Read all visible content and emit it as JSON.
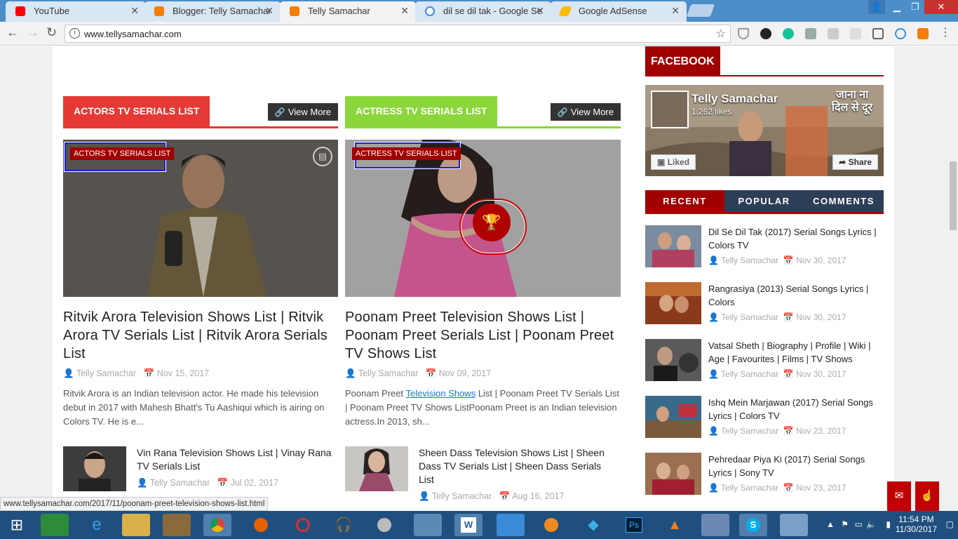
{
  "browser": {
    "tabs": [
      {
        "title": "YouTube",
        "color": "#ff0000"
      },
      {
        "title": "Blogger: Telly Samachar",
        "color": "#f57d00"
      },
      {
        "title": "Telly Samachar",
        "color": "#f57d00"
      },
      {
        "title": "dil se dil tak - Google Se",
        "color": "#4285f4"
      },
      {
        "title": "Google AdSense",
        "color": "#fbbc05"
      }
    ],
    "url": "www.tellysamachar.com",
    "status_url": "www.tellysamachar.com/2017/11/poonam-preet-television-shows-list.html"
  },
  "page": {
    "sections": [
      {
        "heading": "ACTORS TV SERIALS LIST",
        "accent": "#e53935",
        "view_more": "View More",
        "featured": {
          "tag": "ACTORS TV SERIALS LIST",
          "title": "Ritvik Arora Television Shows List | Ritvik Arora TV Serials List | Ritvik Arora Serials List",
          "author": "Telly Samachar",
          "date": "Nov 15, 2017",
          "excerpt": "Ritvik Arora is an Indian television actor. He made his television debut in 2017 with Mahesh Bhatt's Tu Aashiqui which is airing on Colors TV. He is e..."
        },
        "mini": {
          "title": "Vin Rana Television Shows List | Vinay Rana TV Serials List",
          "author": "Telly Samachar",
          "date": "Jul 02, 2017"
        }
      },
      {
        "heading": "ACTRESS TV SERIALS LIST",
        "accent": "#8bd63a",
        "view_more": "View More",
        "featured": {
          "tag": "ACTRESS TV SERIALS LIST",
          "title": "Poonam Preet Television Shows List | Poonam Preet Serials List | Poonam Preet TV Shows List",
          "author": "Telly Samachar",
          "date": "Nov 09, 2017",
          "excerpt_pre": "Poonam Preet ",
          "excerpt_link": "Television Shows",
          "excerpt_post": " List | Poonam Preet TV Serials List | Poonam Preet TV Shows ListPoonam Preet is an Indian television actress.In 2013, sh..."
        },
        "mini": {
          "title": "Sheen Dass Television Shows List | Sheen Dass TV Serials List | Sheen Dass Serials List",
          "author": "Telly Samachar",
          "date": "Aug 16, 2017"
        }
      }
    ]
  },
  "sidebar": {
    "facebook_heading": "FACEBOOK",
    "fb": {
      "page_name": "Telly Samachar",
      "likes": "1,262 likes",
      "liked_label": "Liked",
      "share_label": "Share",
      "cover_text": "जाना ना दिल से दूर"
    },
    "tabs": [
      "RECENT",
      "POPULAR",
      "COMMENTS"
    ],
    "recent": [
      {
        "title": "Dil Se Dil Tak (2017) Serial Songs Lyrics | Colors TV",
        "author": "Telly Samachar",
        "date": "Nov 30, 2017"
      },
      {
        "title": "Rangrasiya (2013) Serial Songs Lyrics | Colors",
        "author": "Telly Samachar",
        "date": "Nov 30, 2017"
      },
      {
        "title": "Vatsal Sheth | Biography | Profile | Wiki | Age | Favourites | Films | TV Shows",
        "author": "Telly Samachar",
        "date": "Nov 30, 2017"
      },
      {
        "title": "Ishq Mein Marjawan (2017) Serial Songs Lyrics | Colors TV",
        "author": "Telly Samachar",
        "date": "Nov 23, 2017"
      },
      {
        "title": "Pehredaar Piya Ki (2017) Serial Songs Lyrics | Sony TV",
        "author": "Telly Samachar",
        "date": "Nov 23, 2017"
      }
    ]
  },
  "taskbar": {
    "time": "11:54 PM",
    "date": "11/30/2017"
  }
}
